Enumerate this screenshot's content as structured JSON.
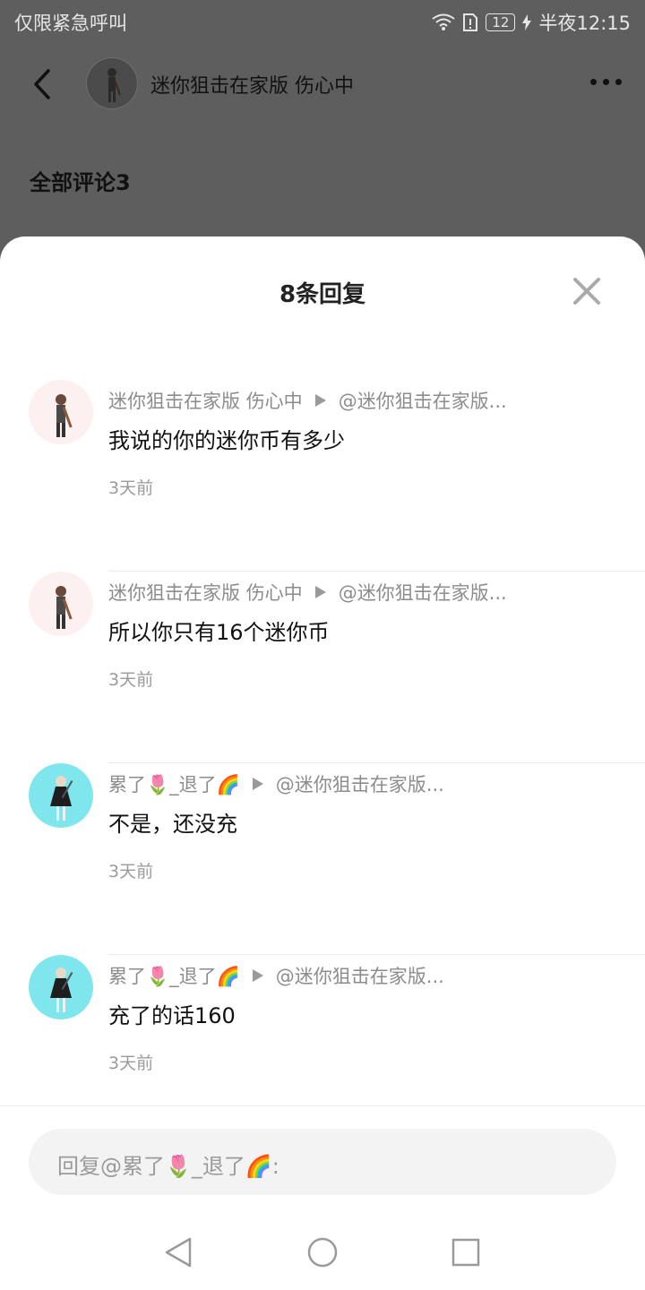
{
  "status_bar": {
    "left_text": "仅限紧急呼叫",
    "battery": "12",
    "time": "半夜12:15"
  },
  "header": {
    "title": "迷你狙击在家版 伤心中"
  },
  "comments": {
    "title": "全部评论3"
  },
  "sheet": {
    "title": "8条回复",
    "replies": [
      {
        "author": "迷你狙击在家版 伤心中",
        "target": "@迷你狙击在家版...",
        "text": "我说的你的迷你币有多少",
        "time": "3天前"
      },
      {
        "author": "迷你狙击在家版 伤心中",
        "target": "@迷你狙击在家版...",
        "text": "所以你只有16个迷你币",
        "time": "3天前"
      },
      {
        "author": "累了🌷_退了🌈",
        "target": "@迷你狙击在家版...",
        "text": "不是，还没充",
        "time": "3天前"
      },
      {
        "author": "累了🌷_退了🌈",
        "target": "@迷你狙击在家版...",
        "text": "充了的话160",
        "time": "3天前"
      }
    ],
    "input_placeholder": "回复@累了🌷_退了🌈:"
  }
}
